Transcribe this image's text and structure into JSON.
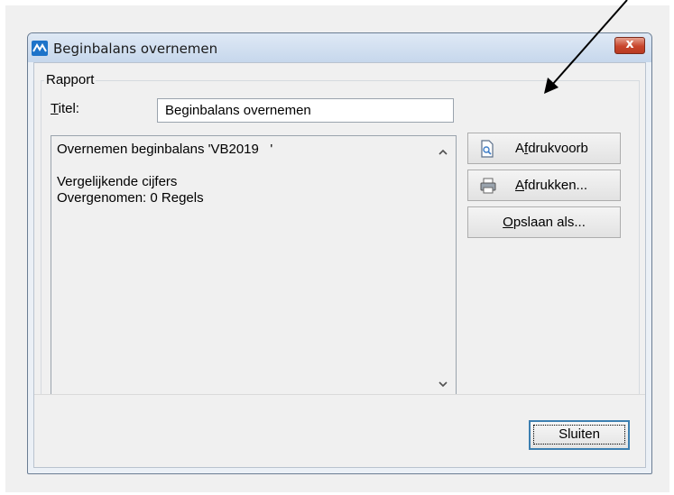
{
  "window": {
    "title": "Beginbalans overnemen",
    "close_glyph": "x"
  },
  "group": {
    "label": "Rapport"
  },
  "titel": {
    "label_first": "T",
    "label_rest": "itel:",
    "value": "Beginbalans overnemen"
  },
  "report": {
    "text": "Overnemen beginbalans 'VB2019   '\n\nVergelijkende cijfers\nOvergenomen: 0 Regels",
    "scroll_up_glyph": "^",
    "scroll_down_glyph": "v"
  },
  "buttons": {
    "preview": {
      "pre": "A",
      "ul": "f",
      "post": "drukvoorb",
      "icon": "print-preview-icon"
    },
    "print": {
      "pre": "",
      "ul": "A",
      "post": "fdrukken...",
      "icon": "printer-icon"
    },
    "save": {
      "pre": "",
      "ul": "O",
      "post": "pslaan als..."
    }
  },
  "footer": {
    "close_label": "Sluiten"
  },
  "colors": {
    "title_bar": "#c6d7ec",
    "close_button": "#c8452c",
    "default_button_border": "#3c7fb1",
    "annotation_arrow": "#000000"
  }
}
